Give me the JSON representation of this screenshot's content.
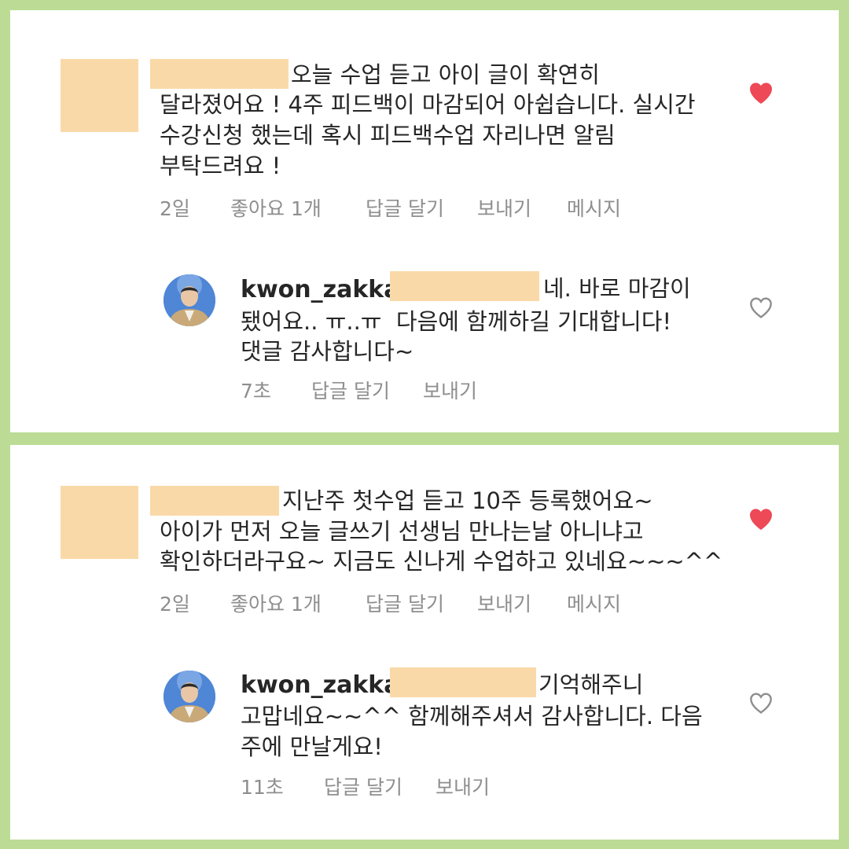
{
  "colors": {
    "frame_bg": "#bcdc96",
    "panel_bg": "#ffffff",
    "redaction": "#fad9a8",
    "text": "#262626",
    "meta_text": "#8e8e8e",
    "heart_filled": "#ed4956"
  },
  "comments": [
    {
      "text_lines": [
        "오늘 수업 듣고 아이 글이 확연히",
        "달라졌어요 ! 4주 피드백이 마감되어 아쉽습니다. 실시간",
        "수강신청 했는데 혹시 피드백수업 자리나면 알림",
        "부탁드려요 !"
      ],
      "time": "2일",
      "likes": "좋아요 1개",
      "reply_label": "답글 달기",
      "send_label": "보내기",
      "message_label": "메시지",
      "like_icon": "heart-filled-icon",
      "reply": {
        "username": "kwon_zakka",
        "text_lines": [
          "네. 바로 마감이",
          "됐어요.. ㅠ..ㅠ  다음에 함께하길 기대합니다!",
          "댓글 감사합니다~"
        ],
        "time": "7초",
        "reply_label": "답글 달기",
        "send_label": "보내기",
        "like_icon": "heart-outline-icon"
      }
    },
    {
      "text_lines": [
        "지난주 첫수업 듣고 10주 등록했어요~",
        "아이가 먼저 오늘 글쓰기 선생님 만나는날 아니냐고",
        "확인하더라구요~ 지금도 신나게 수업하고 있네요~~~^^"
      ],
      "time": "2일",
      "likes": "좋아요 1개",
      "reply_label": "답글 달기",
      "send_label": "보내기",
      "message_label": "메시지",
      "like_icon": "heart-filled-icon",
      "reply": {
        "username": "kwon_zakka",
        "text_lines": [
          "기억해주니",
          "고맙네요~~^^ 함께해주셔서 감사합니다. 다음",
          "주에 만날게요!"
        ],
        "time": "11초",
        "reply_label": "답글 달기",
        "send_label": "보내기",
        "like_icon": "heart-outline-icon"
      }
    }
  ]
}
